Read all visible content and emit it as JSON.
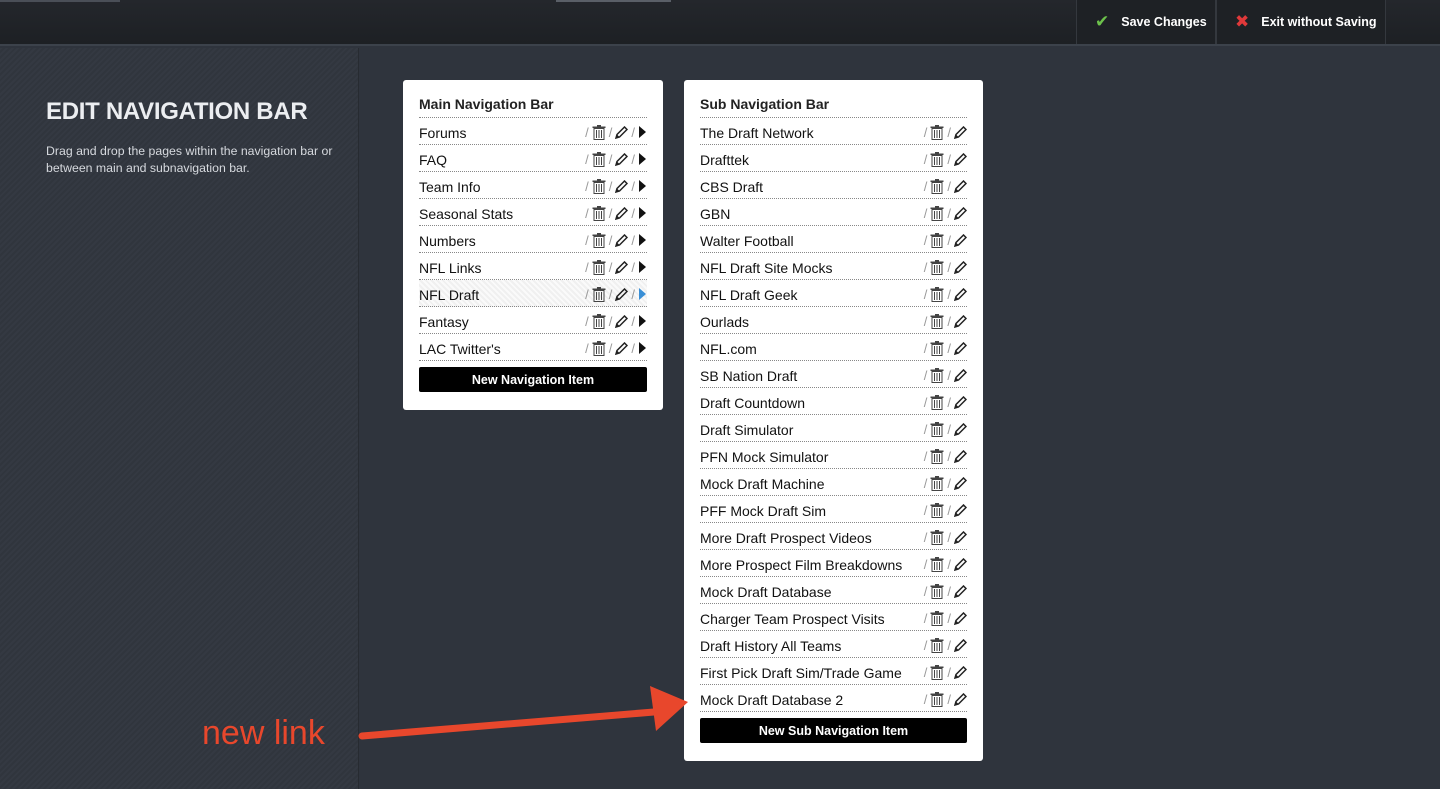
{
  "toolbar": {
    "save_label": "Save Changes",
    "exit_label": "Exit without Saving",
    "save_icon": "checkmark-icon",
    "exit_icon": "x-icon",
    "save_color": "#6cc14b",
    "exit_color": "#e0393a"
  },
  "sidebar": {
    "title": "EDIT NAVIGATION BAR",
    "description": "Drag and drop the pages within the navigation bar or between main and subnavigation bar."
  },
  "main_nav": {
    "title": "Main Navigation Bar",
    "items": [
      {
        "label": "Forums"
      },
      {
        "label": "FAQ"
      },
      {
        "label": "Team Info"
      },
      {
        "label": "Seasonal Stats"
      },
      {
        "label": "Numbers"
      },
      {
        "label": "NFL Links"
      },
      {
        "label": "NFL Draft",
        "highlighted": true
      },
      {
        "label": "Fantasy"
      },
      {
        "label": "LAC Twitter's"
      }
    ],
    "new_button_label": "New Navigation Item"
  },
  "sub_nav": {
    "title": "Sub Navigation Bar",
    "items": [
      {
        "label": "The Draft Network"
      },
      {
        "label": "Drafttek"
      },
      {
        "label": "CBS Draft"
      },
      {
        "label": "GBN"
      },
      {
        "label": "Walter Football"
      },
      {
        "label": "NFL Draft Site Mocks"
      },
      {
        "label": "NFL Draft Geek"
      },
      {
        "label": "Ourlads"
      },
      {
        "label": "NFL.com"
      },
      {
        "label": "SB Nation Draft"
      },
      {
        "label": "Draft Countdown"
      },
      {
        "label": "Draft Simulator"
      },
      {
        "label": "PFN Mock Simulator"
      },
      {
        "label": "Mock Draft Machine"
      },
      {
        "label": "PFF Mock Draft Sim"
      },
      {
        "label": "More Draft Prospect Videos"
      },
      {
        "label": "More Prospect Film Breakdowns"
      },
      {
        "label": "Mock Draft Database"
      },
      {
        "label": "Charger Team Prospect Visits"
      },
      {
        "label": "Draft History All Teams"
      },
      {
        "label": "First Pick Draft Sim/Trade Game"
      },
      {
        "label": "Mock Draft Database 2"
      }
    ],
    "new_button_label": "New Sub Navigation Item"
  },
  "annotation": {
    "text": "new link",
    "color": "#e8472c"
  },
  "separator": "/"
}
